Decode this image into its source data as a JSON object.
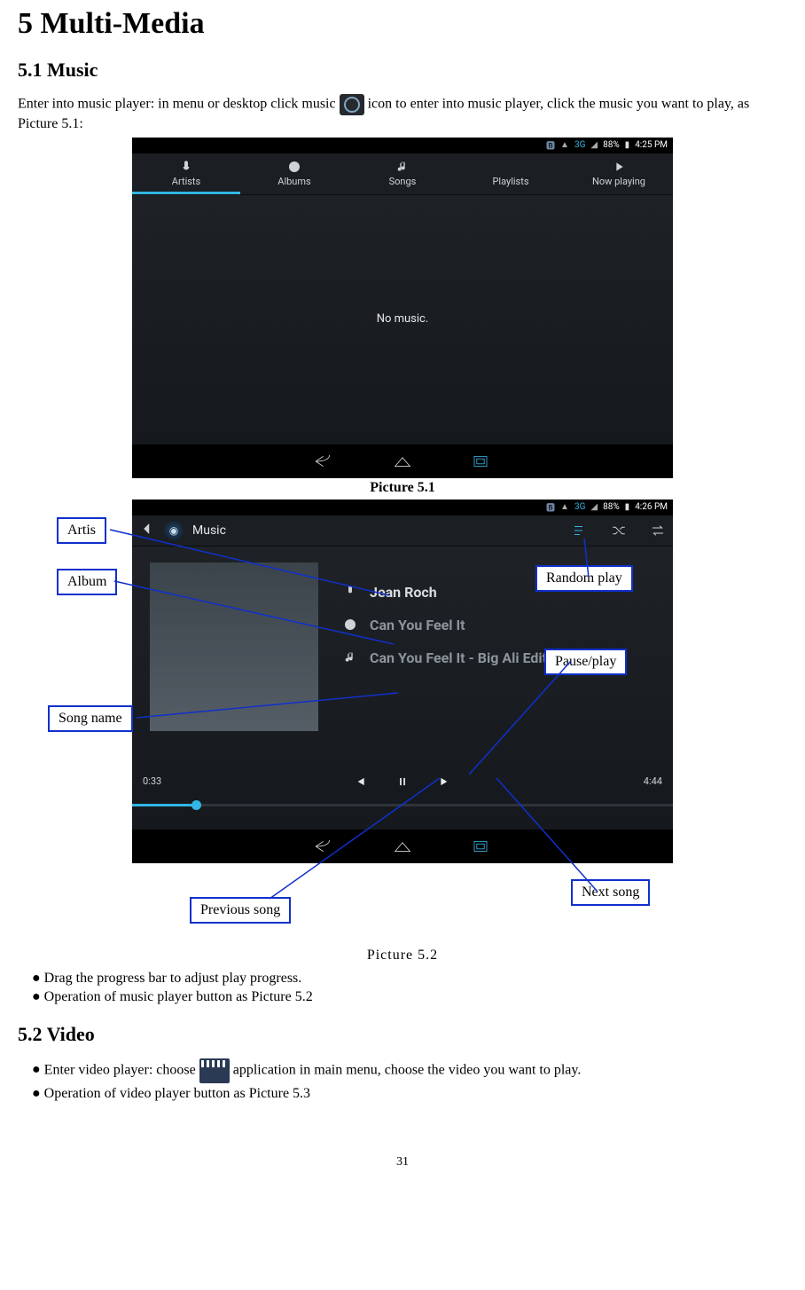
{
  "headings": {
    "h1": "5 Multi-Media",
    "h2_music": "5.1 Music",
    "h2_video": "5.2 Video"
  },
  "paragraphs": {
    "music_intro_before_icon": "Enter into music player: in menu or desktop click music ",
    "music_intro_after_icon": " icon to enter into music player, click the music you want to play, as Picture 5.1:",
    "caption1": "Picture 5.1",
    "caption2": "Picture 5.2",
    "video_intro_before_icon": "Enter video player: choose ",
    "video_intro_after_icon": "application in main menu, choose the video you want to play."
  },
  "bullets": {
    "b1": "Drag the progress bar to adjust play progress.",
    "b2": "Operation of music player button as Picture 5.2",
    "b3": "Operation of video player button as Picture 5.3"
  },
  "screenshot1": {
    "status": {
      "net": "3G",
      "batt": "88%",
      "time": "4:25 PM"
    },
    "tabs": {
      "artists": "Artists",
      "albums": "Albums",
      "songs": "Songs",
      "playlists": "Playlists",
      "nowplaying": "Now playing"
    },
    "empty": "No music."
  },
  "screenshot2": {
    "status": {
      "net": "3G",
      "batt": "88%",
      "time": "4:26 PM"
    },
    "header_title": "Music",
    "artist": "Jean Roch",
    "album": "Can You Feel It",
    "song": "Can You Feel It - Big Ali Edit",
    "elapsed": "0:33",
    "total": "4:44"
  },
  "annotations": {
    "artis": "Artis",
    "album": "Album",
    "songname": "Song name",
    "randomplay": "Random play",
    "pauseplay": "Pause/play",
    "nextsong": "Next song",
    "prevsong": "Previous song"
  },
  "pagenum": "31"
}
